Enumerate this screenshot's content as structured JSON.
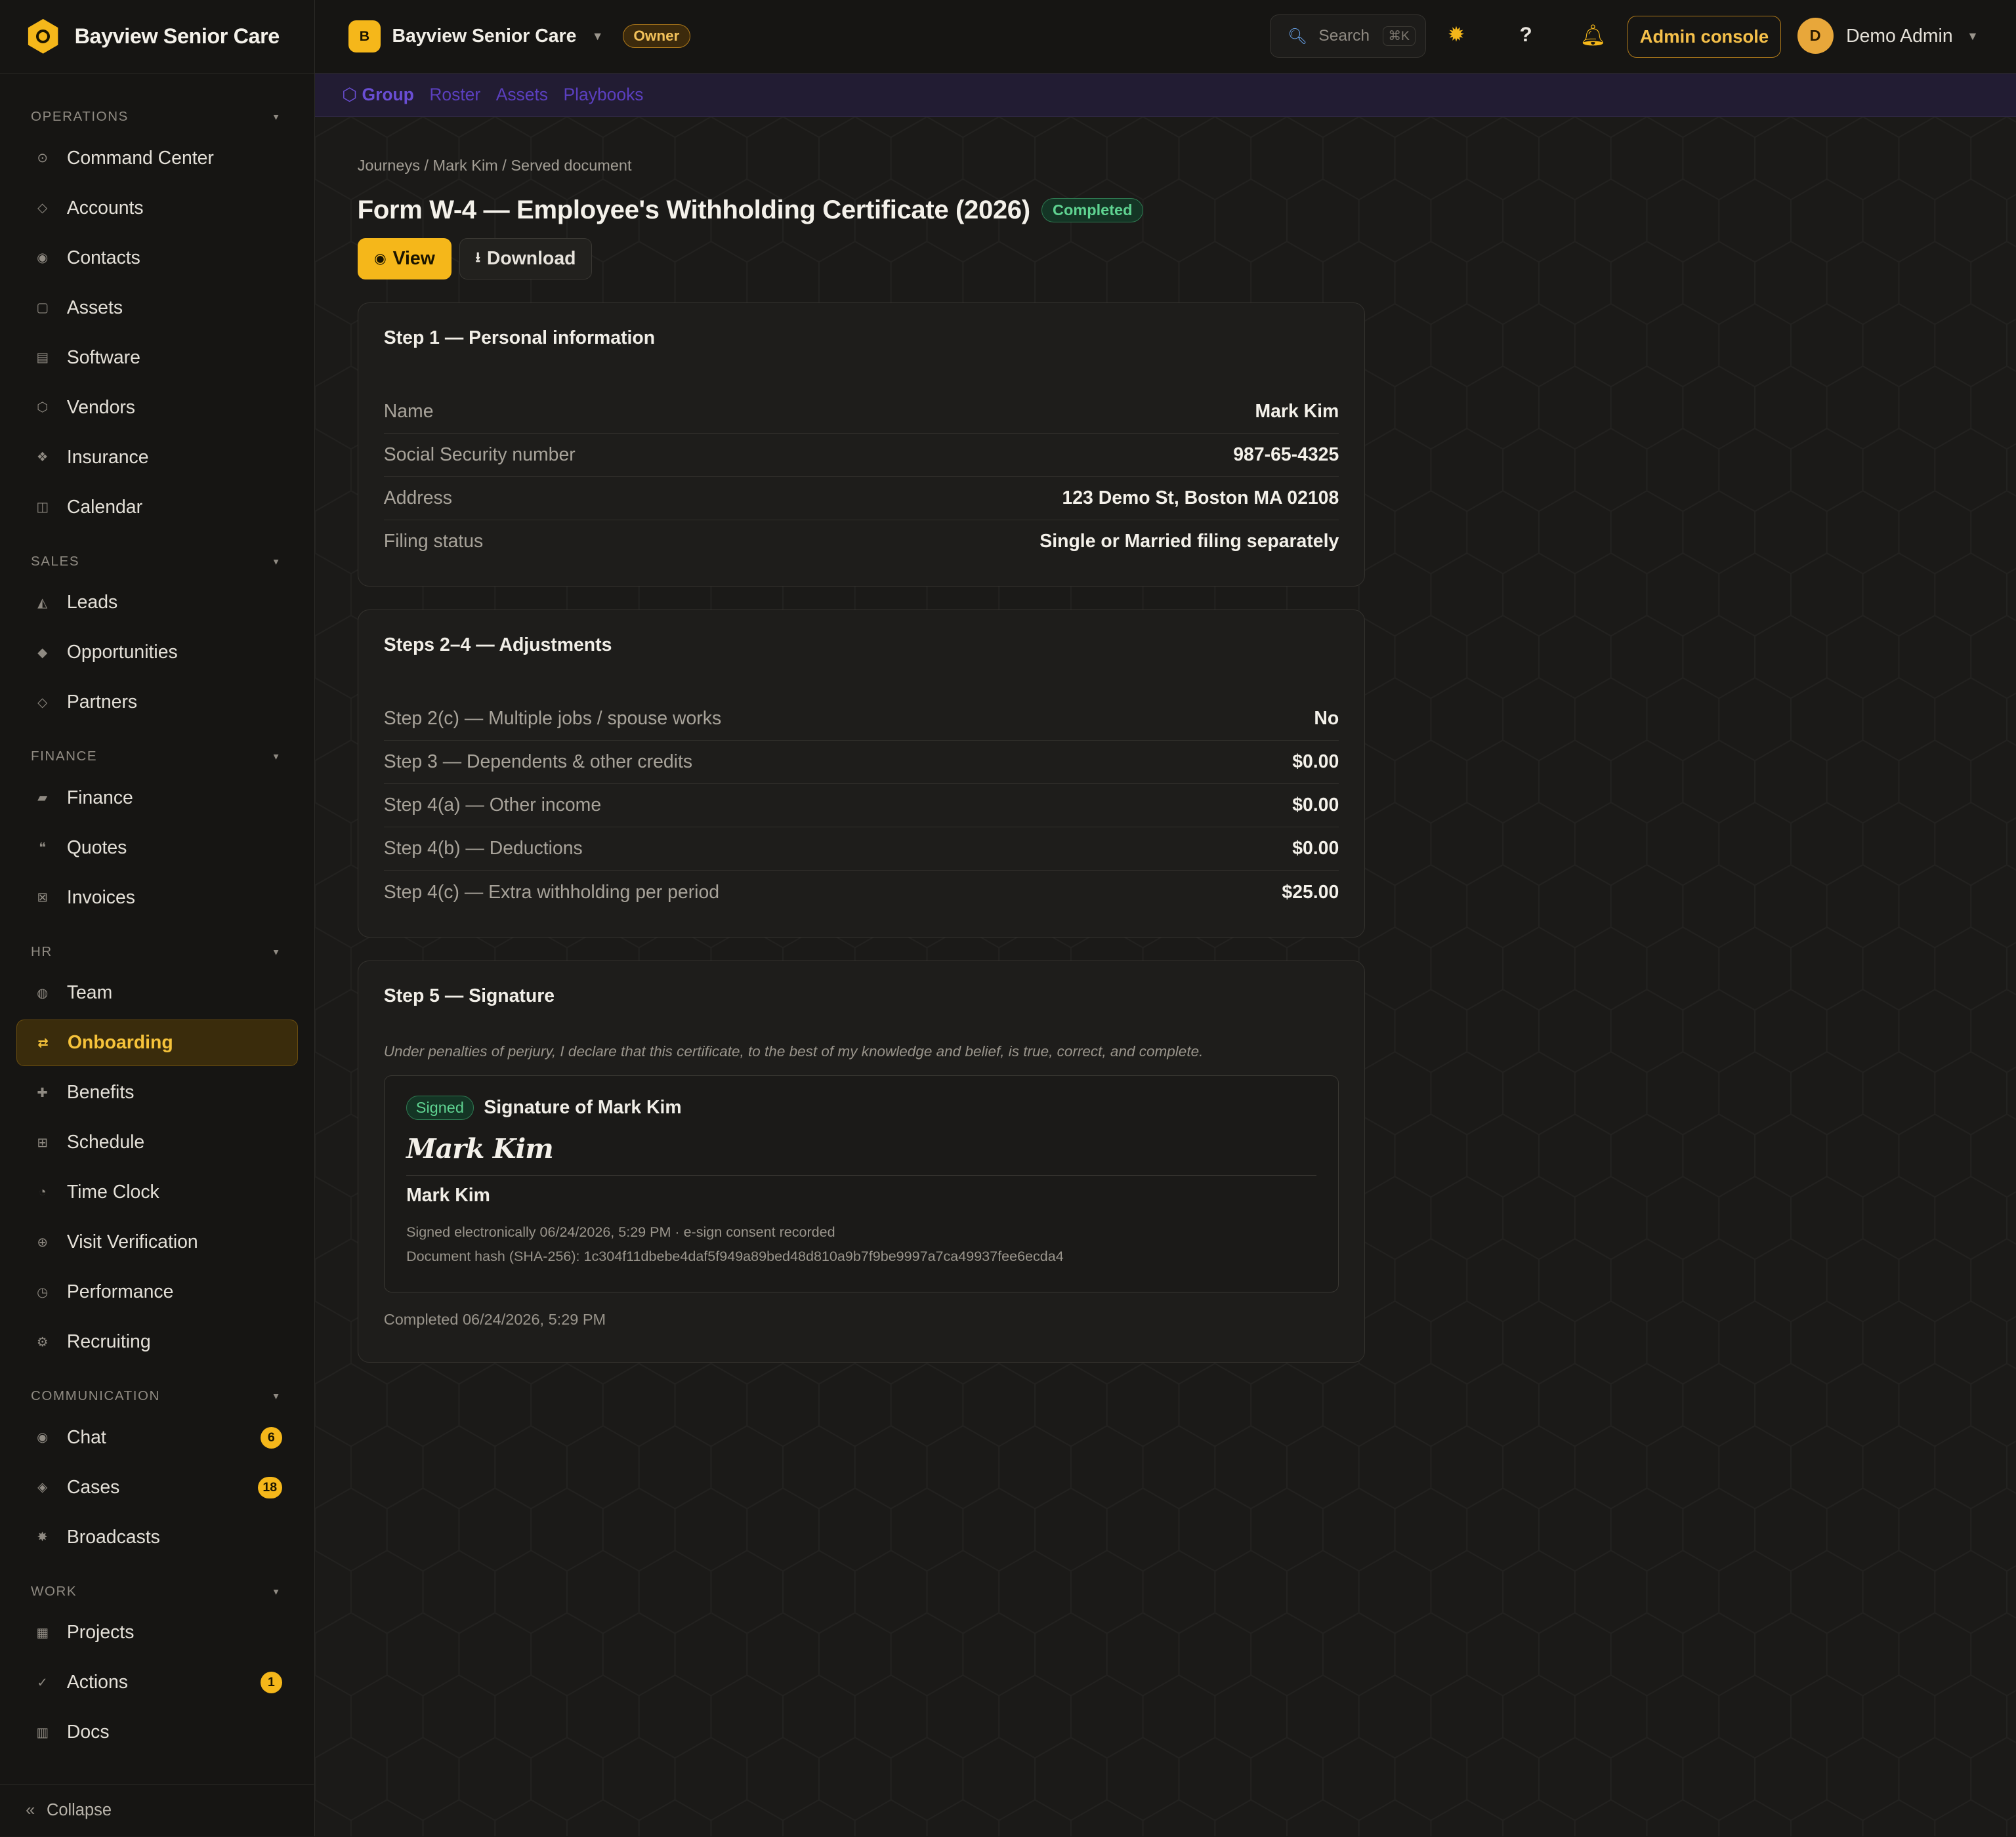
{
  "brand": {
    "name": "Bayview Senior Care"
  },
  "sidebar": {
    "sections": [
      {
        "title": "OPERATIONS",
        "items": [
          {
            "label": "Command Center",
            "icon": "⊙"
          },
          {
            "label": "Accounts",
            "icon": "◇"
          },
          {
            "label": "Contacts",
            "icon": "◉"
          },
          {
            "label": "Assets",
            "icon": "▢"
          },
          {
            "label": "Software",
            "icon": "▤"
          },
          {
            "label": "Vendors",
            "icon": "⬡"
          },
          {
            "label": "Insurance",
            "icon": "❖"
          },
          {
            "label": "Calendar",
            "icon": "◫"
          }
        ]
      },
      {
        "title": "SALES",
        "items": [
          {
            "label": "Leads",
            "icon": "◭"
          },
          {
            "label": "Opportunities",
            "icon": "◆"
          },
          {
            "label": "Partners",
            "icon": "◇"
          }
        ]
      },
      {
        "title": "FINANCE",
        "items": [
          {
            "label": "Finance",
            "icon": "▰"
          },
          {
            "label": "Quotes",
            "icon": "❝"
          },
          {
            "label": "Invoices",
            "icon": "⊠"
          }
        ]
      },
      {
        "title": "HR",
        "items": [
          {
            "label": "Team",
            "icon": "◍"
          },
          {
            "label": "Onboarding",
            "icon": "⇄",
            "active": true
          },
          {
            "label": "Benefits",
            "icon": "✚"
          },
          {
            "label": "Schedule",
            "icon": "⊞"
          },
          {
            "label": "Time Clock",
            "icon": "◔"
          },
          {
            "label": "Visit Verification",
            "icon": "⊕"
          },
          {
            "label": "Performance",
            "icon": "◷"
          },
          {
            "label": "Recruiting",
            "icon": "⚙"
          }
        ]
      },
      {
        "title": "COMMUNICATION",
        "items": [
          {
            "label": "Chat",
            "icon": "◉",
            "badge": "6"
          },
          {
            "label": "Cases",
            "icon": "◈",
            "badge": "18"
          },
          {
            "label": "Broadcasts",
            "icon": "✸"
          }
        ]
      },
      {
        "title": "WORK",
        "items": [
          {
            "label": "Projects",
            "icon": "▦"
          },
          {
            "label": "Actions",
            "icon": "✓",
            "badge": "1"
          },
          {
            "label": "Docs",
            "icon": "▥"
          }
        ]
      }
    ],
    "collapse_label": "Collapse"
  },
  "topbar": {
    "org_initial": "B",
    "org_name": "Bayview Senior Care",
    "role": "Owner",
    "search_placeholder": "Search",
    "search_shortcut": "⌘K",
    "admin_console": "Admin console",
    "user_initial": "D",
    "user_name": "Demo Admin"
  },
  "subnav": {
    "items": [
      "⬡ Group",
      "Roster",
      "Assets",
      "Playbooks"
    ]
  },
  "page": {
    "breadcrumb": "Journeys / Mark Kim / Served document",
    "title": "Form W-4 — Employee's Withholding Certificate (2026)",
    "status": "Completed",
    "view_label": "View",
    "download_label": "Download"
  },
  "step1": {
    "title": "Step 1 — Personal information",
    "rows": [
      {
        "k": "Name",
        "v": "Mark Kim"
      },
      {
        "k": "Social Security number",
        "v": "987-65-4325"
      },
      {
        "k": "Address",
        "v": "123 Demo St, Boston MA 02108"
      },
      {
        "k": "Filing status",
        "v": "Single or Married filing separately"
      }
    ]
  },
  "step2": {
    "title": "Steps 2–4 — Adjustments",
    "rows": [
      {
        "k": "Step 2(c) — Multiple jobs / spouse works",
        "v": "No"
      },
      {
        "k": "Step 3 — Dependents & other credits",
        "v": "$0.00"
      },
      {
        "k": "Step 4(a) — Other income",
        "v": "$0.00"
      },
      {
        "k": "Step 4(b) — Deductions",
        "v": "$0.00"
      },
      {
        "k": "Step 4(c) — Extra withholding per period",
        "v": "$25.00"
      }
    ]
  },
  "step5": {
    "title": "Step 5 — Signature",
    "declaration": "Under penalties of perjury, I declare that this certificate, to the best of my knowledge and belief, is true, correct, and complete.",
    "signed_badge": "Signed",
    "signature_of": "Signature of Mark Kim",
    "signature_script": "Mark Kim",
    "signer_name": "Mark Kim",
    "signed_meta": "Signed electronically 06/24/2026, 5:29 PM · e-sign consent recorded",
    "hash": "Document hash (SHA-256): 1c304f11dbebe4daf5f949a89bed48d810a9b7f9be9997a7ca49937fee6ecda4",
    "completed": "Completed 06/24/2026, 5:29 PM"
  }
}
